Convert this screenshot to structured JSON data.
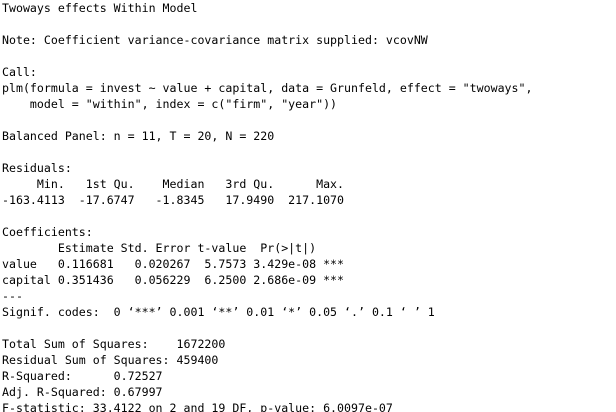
{
  "console": {
    "lines": [
      "Twoways effects Within Model",
      "",
      "Note: Coefficient variance-covariance matrix supplied: vcovNW",
      "",
      "Call:",
      "plm(formula = invest ~ value + capital, data = Grunfeld, effect = \"twoways\",",
      "    model = \"within\", index = c(\"firm\", \"year\"))",
      "",
      "Balanced Panel: n = 11, T = 20, N = 220",
      "",
      "Residuals:",
      "     Min.   1st Qu.    Median   3rd Qu.      Max. ",
      "-163.4113  -17.6747   -1.8345   17.9490  217.1070 ",
      "",
      "Coefficients:",
      "        Estimate Std. Error t-value  Pr(>|t|)    ",
      "value   0.116681   0.020267  5.7573 3.429e-08 ***",
      "capital 0.351436   0.056229  6.2500 2.686e-09 ***",
      "---",
      "Signif. codes:  0 ‘***’ 0.001 ‘**’ 0.01 ‘*’ 0.05 ‘.’ 0.1 ‘ ’ 1",
      "",
      "Total Sum of Squares:    1672200",
      "Residual Sum of Squares: 459400",
      "R-Squared:      0.72527",
      "Adj. R-Squared: 0.67997",
      "F-statistic: 33.4122 on 2 and 19 DF, p-value: 6.0097e-07"
    ]
  }
}
